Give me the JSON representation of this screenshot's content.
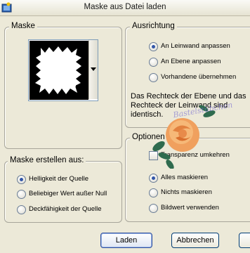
{
  "window": {
    "title": "Maske aus Datei laden",
    "app_icon": "image-icon"
  },
  "mask_group": {
    "label": "Maske"
  },
  "create_group": {
    "label": "Maske erstellen aus:",
    "options": [
      {
        "label": "Helligkeit der Quelle",
        "selected": true
      },
      {
        "label": "Beliebiger Wert außer Null",
        "selected": false
      },
      {
        "label": "Deckfähigkeit der Quelle",
        "selected": false
      }
    ]
  },
  "orientation_group": {
    "label": "Ausrichtung",
    "options": [
      {
        "label": "An Leinwand anpassen",
        "selected": true
      },
      {
        "label": "An Ebene anpassen",
        "selected": false
      },
      {
        "label": "Vorhandene übernehmen",
        "selected": false
      }
    ],
    "description_lines": [
      "Das Rechteck der Ebene und das",
      "Rechteck der Leinwand sind",
      "identisch."
    ]
  },
  "options_group": {
    "label": "Optionen",
    "invert": {
      "label": "Transparenz umkehren",
      "checked": false
    },
    "options": [
      {
        "label": "Alles maskieren",
        "selected": true
      },
      {
        "label": "Nichts maskieren",
        "selected": false
      },
      {
        "label": "Bildwert verwenden",
        "selected": false
      }
    ]
  },
  "watermark": {
    "text": "Bastelstübchen"
  },
  "buttons": {
    "ok": "Laden",
    "cancel": "Abbrechen",
    "third_partial": ""
  },
  "colors": {
    "dialog_bg": "#ece9d8",
    "radio_dot": "#3256a8",
    "watermark": "#6b5fd0"
  }
}
